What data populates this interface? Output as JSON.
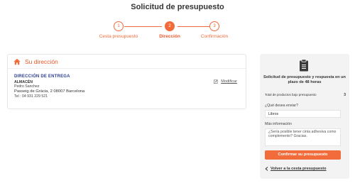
{
  "header": {
    "title": "Solicitud de presupuesto"
  },
  "stepper": {
    "steps": [
      {
        "number": "1",
        "label": "Cesta presupuesto"
      },
      {
        "number": "2",
        "label": "Dirección"
      },
      {
        "number": "3",
        "label": "Confirmación"
      }
    ],
    "active_step": 2
  },
  "address": {
    "section_title": "Su dirección",
    "delivery_title": "DIRECCIÓN DE ENTREGA",
    "warehouse": "ALMACÉN",
    "contact_name": "Pedro Sanchez",
    "street": "Passeig de Gràcia, 2 08007 Barcelona",
    "phone": "Tel : 04 931 229 521",
    "modify_label": "Modificar"
  },
  "sidebar": {
    "heading": "Solicitud de presupuesto y respuesta en un plazo de 48 horas",
    "total_label": "Total de productos bajo presupuesto",
    "total_count": "3",
    "send_question": "¿Qué desea enviar?",
    "send_value": "Libros",
    "more_info_label": "Más información",
    "more_info_value": "¿Sería posible tener cinta adhesiva como complemento? Gracias.",
    "confirm_button": "Confirmar su presupuesto",
    "back_link": "Volver a la cesta presupuesto"
  },
  "colors": {
    "accent": "#f26b3a",
    "delivery_title": "#2c3f8f",
    "sidebar_bg": "#f3f3f3"
  },
  "icons": {
    "section": "home-icon",
    "modify": "edit-icon",
    "sidebar": "clipboard-icon",
    "back": "chevron-left-icon"
  }
}
